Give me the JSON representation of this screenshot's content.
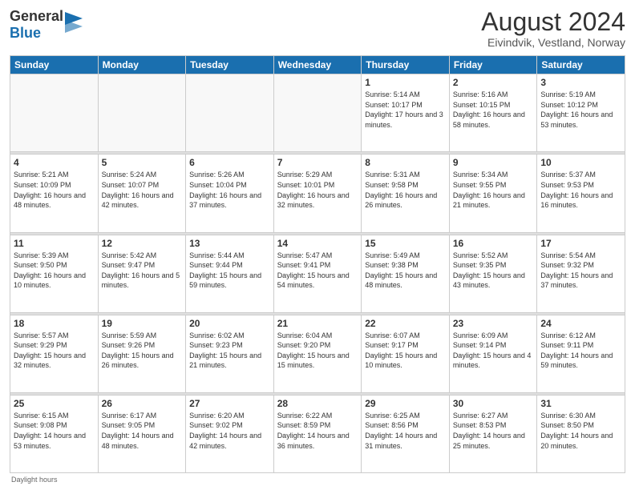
{
  "header": {
    "logo_general": "General",
    "logo_blue": "Blue",
    "month_title": "August 2024",
    "location": "Eivindvik, Vestland, Norway"
  },
  "days_of_week": [
    "Sunday",
    "Monday",
    "Tuesday",
    "Wednesday",
    "Thursday",
    "Friday",
    "Saturday"
  ],
  "weeks": [
    {
      "days": [
        {
          "num": "",
          "info": ""
        },
        {
          "num": "",
          "info": ""
        },
        {
          "num": "",
          "info": ""
        },
        {
          "num": "",
          "info": ""
        },
        {
          "num": "1",
          "sunrise": "Sunrise: 5:14 AM",
          "sunset": "Sunset: 10:17 PM",
          "daylight": "Daylight: 17 hours and 3 minutes."
        },
        {
          "num": "2",
          "sunrise": "Sunrise: 5:16 AM",
          "sunset": "Sunset: 10:15 PM",
          "daylight": "Daylight: 16 hours and 58 minutes."
        },
        {
          "num": "3",
          "sunrise": "Sunrise: 5:19 AM",
          "sunset": "Sunset: 10:12 PM",
          "daylight": "Daylight: 16 hours and 53 minutes."
        }
      ]
    },
    {
      "days": [
        {
          "num": "4",
          "sunrise": "Sunrise: 5:21 AM",
          "sunset": "Sunset: 10:09 PM",
          "daylight": "Daylight: 16 hours and 48 minutes."
        },
        {
          "num": "5",
          "sunrise": "Sunrise: 5:24 AM",
          "sunset": "Sunset: 10:07 PM",
          "daylight": "Daylight: 16 hours and 42 minutes."
        },
        {
          "num": "6",
          "sunrise": "Sunrise: 5:26 AM",
          "sunset": "Sunset: 10:04 PM",
          "daylight": "Daylight: 16 hours and 37 minutes."
        },
        {
          "num": "7",
          "sunrise": "Sunrise: 5:29 AM",
          "sunset": "Sunset: 10:01 PM",
          "daylight": "Daylight: 16 hours and 32 minutes."
        },
        {
          "num": "8",
          "sunrise": "Sunrise: 5:31 AM",
          "sunset": "Sunset: 9:58 PM",
          "daylight": "Daylight: 16 hours and 26 minutes."
        },
        {
          "num": "9",
          "sunrise": "Sunrise: 5:34 AM",
          "sunset": "Sunset: 9:55 PM",
          "daylight": "Daylight: 16 hours and 21 minutes."
        },
        {
          "num": "10",
          "sunrise": "Sunrise: 5:37 AM",
          "sunset": "Sunset: 9:53 PM",
          "daylight": "Daylight: 16 hours and 16 minutes."
        }
      ]
    },
    {
      "days": [
        {
          "num": "11",
          "sunrise": "Sunrise: 5:39 AM",
          "sunset": "Sunset: 9:50 PM",
          "daylight": "Daylight: 16 hours and 10 minutes."
        },
        {
          "num": "12",
          "sunrise": "Sunrise: 5:42 AM",
          "sunset": "Sunset: 9:47 PM",
          "daylight": "Daylight: 16 hours and 5 minutes."
        },
        {
          "num": "13",
          "sunrise": "Sunrise: 5:44 AM",
          "sunset": "Sunset: 9:44 PM",
          "daylight": "Daylight: 15 hours and 59 minutes."
        },
        {
          "num": "14",
          "sunrise": "Sunrise: 5:47 AM",
          "sunset": "Sunset: 9:41 PM",
          "daylight": "Daylight: 15 hours and 54 minutes."
        },
        {
          "num": "15",
          "sunrise": "Sunrise: 5:49 AM",
          "sunset": "Sunset: 9:38 PM",
          "daylight": "Daylight: 15 hours and 48 minutes."
        },
        {
          "num": "16",
          "sunrise": "Sunrise: 5:52 AM",
          "sunset": "Sunset: 9:35 PM",
          "daylight": "Daylight: 15 hours and 43 minutes."
        },
        {
          "num": "17",
          "sunrise": "Sunrise: 5:54 AM",
          "sunset": "Sunset: 9:32 PM",
          "daylight": "Daylight: 15 hours and 37 minutes."
        }
      ]
    },
    {
      "days": [
        {
          "num": "18",
          "sunrise": "Sunrise: 5:57 AM",
          "sunset": "Sunset: 9:29 PM",
          "daylight": "Daylight: 15 hours and 32 minutes."
        },
        {
          "num": "19",
          "sunrise": "Sunrise: 5:59 AM",
          "sunset": "Sunset: 9:26 PM",
          "daylight": "Daylight: 15 hours and 26 minutes."
        },
        {
          "num": "20",
          "sunrise": "Sunrise: 6:02 AM",
          "sunset": "Sunset: 9:23 PM",
          "daylight": "Daylight: 15 hours and 21 minutes."
        },
        {
          "num": "21",
          "sunrise": "Sunrise: 6:04 AM",
          "sunset": "Sunset: 9:20 PM",
          "daylight": "Daylight: 15 hours and 15 minutes."
        },
        {
          "num": "22",
          "sunrise": "Sunrise: 6:07 AM",
          "sunset": "Sunset: 9:17 PM",
          "daylight": "Daylight: 15 hours and 10 minutes."
        },
        {
          "num": "23",
          "sunrise": "Sunrise: 6:09 AM",
          "sunset": "Sunset: 9:14 PM",
          "daylight": "Daylight: 15 hours and 4 minutes."
        },
        {
          "num": "24",
          "sunrise": "Sunrise: 6:12 AM",
          "sunset": "Sunset: 9:11 PM",
          "daylight": "Daylight: 14 hours and 59 minutes."
        }
      ]
    },
    {
      "days": [
        {
          "num": "25",
          "sunrise": "Sunrise: 6:15 AM",
          "sunset": "Sunset: 9:08 PM",
          "daylight": "Daylight: 14 hours and 53 minutes."
        },
        {
          "num": "26",
          "sunrise": "Sunrise: 6:17 AM",
          "sunset": "Sunset: 9:05 PM",
          "daylight": "Daylight: 14 hours and 48 minutes."
        },
        {
          "num": "27",
          "sunrise": "Sunrise: 6:20 AM",
          "sunset": "Sunset: 9:02 PM",
          "daylight": "Daylight: 14 hours and 42 minutes."
        },
        {
          "num": "28",
          "sunrise": "Sunrise: 6:22 AM",
          "sunset": "Sunset: 8:59 PM",
          "daylight": "Daylight: 14 hours and 36 minutes."
        },
        {
          "num": "29",
          "sunrise": "Sunrise: 6:25 AM",
          "sunset": "Sunset: 8:56 PM",
          "daylight": "Daylight: 14 hours and 31 minutes."
        },
        {
          "num": "30",
          "sunrise": "Sunrise: 6:27 AM",
          "sunset": "Sunset: 8:53 PM",
          "daylight": "Daylight: 14 hours and 25 minutes."
        },
        {
          "num": "31",
          "sunrise": "Sunrise: 6:30 AM",
          "sunset": "Sunset: 8:50 PM",
          "daylight": "Daylight: 14 hours and 20 minutes."
        }
      ]
    }
  ],
  "footer": {
    "note": "Daylight hours"
  }
}
